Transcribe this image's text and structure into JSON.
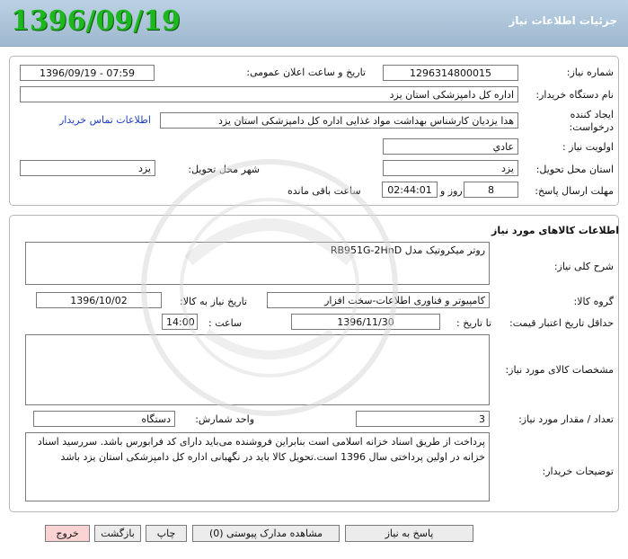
{
  "header": {
    "title": "جزئیات اطلاعات نیاز",
    "date_stamp": "1396/09/19"
  },
  "info": {
    "need_number_label": "شماره نیاز:",
    "need_number": "1296314800015",
    "announce_label": "تاریخ و ساعت اعلان عمومی:",
    "announce_value": "1396/09/19 - 07:59",
    "buyer_org_label": "نام دستگاه خریدار:",
    "buyer_org": "اداره کل دامپزشکی استان یزد",
    "requester_label": "ایجاد کننده درخواست:",
    "requester": "هدا یزدیان کارشناس بهداشت مواد غذایی اداره کل دامپزشکی استان یزد",
    "contact_link": "اطلاعات تماس خریدار",
    "priority_label": "اولویت نیاز :",
    "priority": "عادي",
    "province_label": "استان محل تحویل:",
    "province": "یزد",
    "city_label": "شهر محل تحویل:",
    "city": "یزد",
    "deadline_label": "مهلت ارسال پاسخ:",
    "deadline_days": "8",
    "days_word": "روز و",
    "deadline_time": "02:44:01",
    "remaining_text": "ساعت باقی مانده"
  },
  "goods": {
    "section_title": "اطلاعات کالاهای مورد نیاز",
    "desc_label": "شرح کلی نیاز:",
    "desc": "روتر میکروتیک مدل RB951G-2HnD",
    "group_label": "گروه کالا:",
    "group": "کامپیوتر و فناوری اطلاعات-سخت افزار",
    "need_date_label": "تاریخ نیاز به کالا:",
    "need_date": "1396/10/02",
    "validity_label": "حداقل تاریخ اعتبار قیمت:",
    "until_label": "تا تاریخ :",
    "validity_date": "1396/11/30",
    "time_label": "ساعت :",
    "validity_time": "14:00",
    "specs_label": "مشخصات کالای مورد نیاز:",
    "specs": "",
    "qty_label": "تعداد / مقدار مورد نیاز:",
    "qty": "3",
    "unit_label": "واحد شمارش:",
    "unit": "دستگاه",
    "buyer_notes_label": "توضیحات خریدار:",
    "buyer_notes": "پرداخت از طریق اسناد خزانه اسلامی است بنابراین فروشنده می‌باید دارای کد فرابورس باشد. سررسید اسناد خزانه در اولین پرداختی سال 1396 است.تحویل کالا باید در نگهبانی اداره کل دامپزشکی استان یزد باشد"
  },
  "buttons": {
    "reply": "پاسخ به نیاز",
    "attachments": "مشاهده مدارک پیوستی (0)",
    "print": "چاپ",
    "back": "بازگشت",
    "exit": "خروج"
  },
  "colors": {
    "header_bg": "#a9c2d8",
    "date_green": "#1db81d",
    "link_blue": "#1d3fbf",
    "exit_pink": "#fbd3d3"
  }
}
